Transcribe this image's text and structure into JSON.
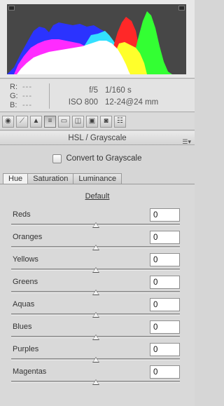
{
  "info": {
    "rgb": [
      {
        "channel": "R:",
        "value": "---"
      },
      {
        "channel": "G:",
        "value": "---"
      },
      {
        "channel": "B:",
        "value": "---"
      }
    ],
    "aperture": "f/5",
    "shutter": "1/160 s",
    "iso": "ISO 800",
    "lens": "12-24@24 mm"
  },
  "toolbar": {
    "icons": [
      "basic-icon",
      "tone-curve-icon",
      "detail-icon",
      "hsl-icon",
      "split-toning-icon",
      "lens-corrections-icon",
      "effects-icon",
      "camera-calibration-icon",
      "presets-icon"
    ],
    "active_index": 3
  },
  "panel": {
    "title": "HSL / Grayscale",
    "convert_label": "Convert to Grayscale",
    "tabs": [
      "Hue",
      "Saturation",
      "Luminance"
    ],
    "active_tab": "Hue",
    "default_label": "Default"
  },
  "sliders": [
    {
      "label": "Reds",
      "value": "0",
      "position": 0.5
    },
    {
      "label": "Oranges",
      "value": "0",
      "position": 0.5
    },
    {
      "label": "Yellows",
      "value": "0",
      "position": 0.5
    },
    {
      "label": "Greens",
      "value": "0",
      "position": 0.5
    },
    {
      "label": "Aquas",
      "value": "0",
      "position": 0.5
    },
    {
      "label": "Blues",
      "value": "0",
      "position": 0.5
    },
    {
      "label": "Purples",
      "value": "0",
      "position": 0.5
    },
    {
      "label": "Magentas",
      "value": "0",
      "position": 0.5
    }
  ],
  "colors": {
    "histogram_bg": "#474747",
    "blue": "#2b33ff",
    "cyan": "#33e0ff",
    "magenta": "#ff2bff",
    "red": "#ff2828",
    "yellow": "#ffff2b",
    "green": "#33ff33",
    "white": "#ffffff"
  }
}
